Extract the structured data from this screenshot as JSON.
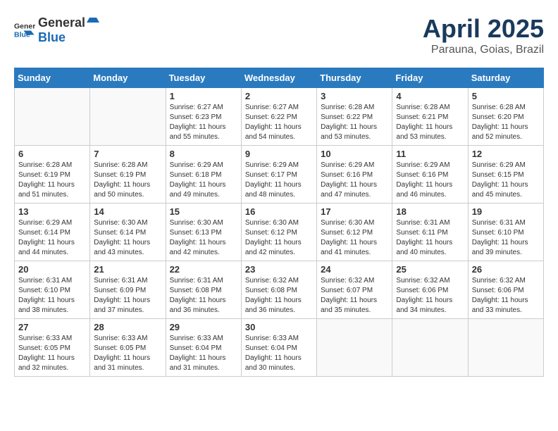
{
  "logo": {
    "general": "General",
    "blue": "Blue"
  },
  "title": "April 2025",
  "subtitle": "Parauna, Goias, Brazil",
  "days_of_week": [
    "Sunday",
    "Monday",
    "Tuesday",
    "Wednesday",
    "Thursday",
    "Friday",
    "Saturday"
  ],
  "weeks": [
    [
      {
        "day": "",
        "detail": ""
      },
      {
        "day": "",
        "detail": ""
      },
      {
        "day": "1",
        "detail": "Sunrise: 6:27 AM\nSunset: 6:23 PM\nDaylight: 11 hours and 55 minutes."
      },
      {
        "day": "2",
        "detail": "Sunrise: 6:27 AM\nSunset: 6:22 PM\nDaylight: 11 hours and 54 minutes."
      },
      {
        "day": "3",
        "detail": "Sunrise: 6:28 AM\nSunset: 6:22 PM\nDaylight: 11 hours and 53 minutes."
      },
      {
        "day": "4",
        "detail": "Sunrise: 6:28 AM\nSunset: 6:21 PM\nDaylight: 11 hours and 53 minutes."
      },
      {
        "day": "5",
        "detail": "Sunrise: 6:28 AM\nSunset: 6:20 PM\nDaylight: 11 hours and 52 minutes."
      }
    ],
    [
      {
        "day": "6",
        "detail": "Sunrise: 6:28 AM\nSunset: 6:19 PM\nDaylight: 11 hours and 51 minutes."
      },
      {
        "day": "7",
        "detail": "Sunrise: 6:28 AM\nSunset: 6:19 PM\nDaylight: 11 hours and 50 minutes."
      },
      {
        "day": "8",
        "detail": "Sunrise: 6:29 AM\nSunset: 6:18 PM\nDaylight: 11 hours and 49 minutes."
      },
      {
        "day": "9",
        "detail": "Sunrise: 6:29 AM\nSunset: 6:17 PM\nDaylight: 11 hours and 48 minutes."
      },
      {
        "day": "10",
        "detail": "Sunrise: 6:29 AM\nSunset: 6:16 PM\nDaylight: 11 hours and 47 minutes."
      },
      {
        "day": "11",
        "detail": "Sunrise: 6:29 AM\nSunset: 6:16 PM\nDaylight: 11 hours and 46 minutes."
      },
      {
        "day": "12",
        "detail": "Sunrise: 6:29 AM\nSunset: 6:15 PM\nDaylight: 11 hours and 45 minutes."
      }
    ],
    [
      {
        "day": "13",
        "detail": "Sunrise: 6:29 AM\nSunset: 6:14 PM\nDaylight: 11 hours and 44 minutes."
      },
      {
        "day": "14",
        "detail": "Sunrise: 6:30 AM\nSunset: 6:14 PM\nDaylight: 11 hours and 43 minutes."
      },
      {
        "day": "15",
        "detail": "Sunrise: 6:30 AM\nSunset: 6:13 PM\nDaylight: 11 hours and 42 minutes."
      },
      {
        "day": "16",
        "detail": "Sunrise: 6:30 AM\nSunset: 6:12 PM\nDaylight: 11 hours and 42 minutes."
      },
      {
        "day": "17",
        "detail": "Sunrise: 6:30 AM\nSunset: 6:12 PM\nDaylight: 11 hours and 41 minutes."
      },
      {
        "day": "18",
        "detail": "Sunrise: 6:31 AM\nSunset: 6:11 PM\nDaylight: 11 hours and 40 minutes."
      },
      {
        "day": "19",
        "detail": "Sunrise: 6:31 AM\nSunset: 6:10 PM\nDaylight: 11 hours and 39 minutes."
      }
    ],
    [
      {
        "day": "20",
        "detail": "Sunrise: 6:31 AM\nSunset: 6:10 PM\nDaylight: 11 hours and 38 minutes."
      },
      {
        "day": "21",
        "detail": "Sunrise: 6:31 AM\nSunset: 6:09 PM\nDaylight: 11 hours and 37 minutes."
      },
      {
        "day": "22",
        "detail": "Sunrise: 6:31 AM\nSunset: 6:08 PM\nDaylight: 11 hours and 36 minutes."
      },
      {
        "day": "23",
        "detail": "Sunrise: 6:32 AM\nSunset: 6:08 PM\nDaylight: 11 hours and 36 minutes."
      },
      {
        "day": "24",
        "detail": "Sunrise: 6:32 AM\nSunset: 6:07 PM\nDaylight: 11 hours and 35 minutes."
      },
      {
        "day": "25",
        "detail": "Sunrise: 6:32 AM\nSunset: 6:06 PM\nDaylight: 11 hours and 34 minutes."
      },
      {
        "day": "26",
        "detail": "Sunrise: 6:32 AM\nSunset: 6:06 PM\nDaylight: 11 hours and 33 minutes."
      }
    ],
    [
      {
        "day": "27",
        "detail": "Sunrise: 6:33 AM\nSunset: 6:05 PM\nDaylight: 11 hours and 32 minutes."
      },
      {
        "day": "28",
        "detail": "Sunrise: 6:33 AM\nSunset: 6:05 PM\nDaylight: 11 hours and 31 minutes."
      },
      {
        "day": "29",
        "detail": "Sunrise: 6:33 AM\nSunset: 6:04 PM\nDaylight: 11 hours and 31 minutes."
      },
      {
        "day": "30",
        "detail": "Sunrise: 6:33 AM\nSunset: 6:04 PM\nDaylight: 11 hours and 30 minutes."
      },
      {
        "day": "",
        "detail": ""
      },
      {
        "day": "",
        "detail": ""
      },
      {
        "day": "",
        "detail": ""
      }
    ]
  ]
}
